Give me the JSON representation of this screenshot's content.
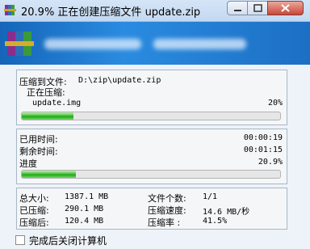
{
  "window": {
    "title": "20.9% 正在创建压缩文件 update.zip"
  },
  "colors": {
    "accent": "#1e6fc2",
    "progress_fill": "#2aa820"
  },
  "icons": {
    "app": "winrar-books-icon",
    "banner_logo": "winrar-books-icon"
  },
  "archive_panel": {
    "archive_label": "压缩到文件:",
    "archive_path": "D:\\zip\\update.zip",
    "status_label": "正在压缩:",
    "current_file": "update.img",
    "file_percent": "20%",
    "file_progress": 0.2
  },
  "time_panel": {
    "elapsed_label": "已用时间:",
    "elapsed_value": "00:00:19",
    "remaining_label": "剩余时间:",
    "remaining_value": "00:01:15",
    "progress_label": "进度",
    "progress_value": "20.9%",
    "total_progress": 0.209
  },
  "stats_panel": {
    "total_size_label": "总大小:",
    "total_size_value": "1387.1 MB",
    "processed_label": "已压缩:",
    "processed_value": "290.1 MB",
    "compressed_label": "压缩后:",
    "compressed_value": "120.4 MB",
    "file_count_label": "文件个数:",
    "file_count_value": "1/1",
    "speed_label": "压缩速度:",
    "speed_value": "14.6 MB/秒",
    "ratio_label": "压缩率 :",
    "ratio_value": "41.5%"
  },
  "options": {
    "shutdown_label": "完成后关闭计算机"
  }
}
